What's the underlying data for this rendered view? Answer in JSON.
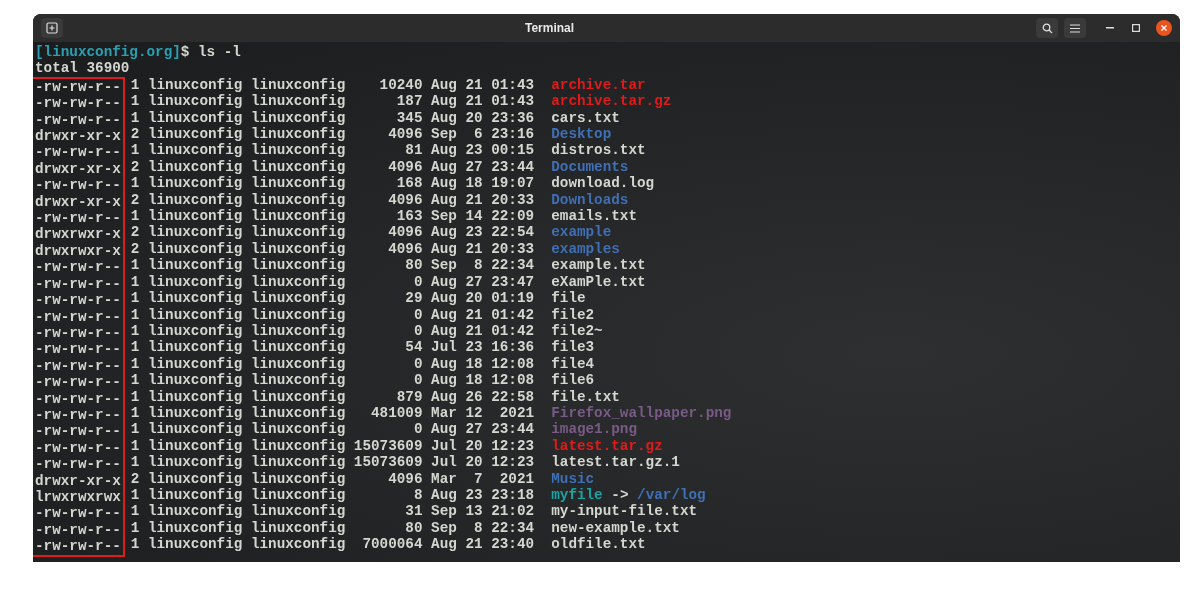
{
  "window": {
    "title": "Terminal"
  },
  "prompt": {
    "host": "[linuxconfig.org]",
    "command": "$ ls -l"
  },
  "total": "total 36900",
  "highlight_permissions": true,
  "rows": [
    {
      "perms": "-rw-rw-r--",
      "details": "1 linuxconfig linuxconfig    10240 Aug 21 01:43",
      "name": "archive.tar",
      "kind": "archive"
    },
    {
      "perms": "-rw-rw-r--",
      "details": "1 linuxconfig linuxconfig      187 Aug 21 01:43",
      "name": "archive.tar.gz",
      "kind": "archive"
    },
    {
      "perms": "-rw-rw-r--",
      "details": "1 linuxconfig linuxconfig      345 Aug 20 23:36",
      "name": "cars.txt",
      "kind": "file"
    },
    {
      "perms": "drwxr-xr-x",
      "details": "2 linuxconfig linuxconfig     4096 Sep  6 23:16",
      "name": "Desktop",
      "kind": "dir"
    },
    {
      "perms": "-rw-rw-r--",
      "details": "1 linuxconfig linuxconfig       81 Aug 23 00:15",
      "name": "distros.txt",
      "kind": "file"
    },
    {
      "perms": "drwxr-xr-x",
      "details": "2 linuxconfig linuxconfig     4096 Aug 27 23:44",
      "name": "Documents",
      "kind": "dir"
    },
    {
      "perms": "-rw-rw-r--",
      "details": "1 linuxconfig linuxconfig      168 Aug 18 19:07",
      "name": "download.log",
      "kind": "file"
    },
    {
      "perms": "drwxr-xr-x",
      "details": "2 linuxconfig linuxconfig     4096 Aug 21 20:33",
      "name": "Downloads",
      "kind": "dir"
    },
    {
      "perms": "-rw-rw-r--",
      "details": "1 linuxconfig linuxconfig      163 Sep 14 22:09",
      "name": "emails.txt",
      "kind": "file"
    },
    {
      "perms": "drwxrwxr-x",
      "details": "2 linuxconfig linuxconfig     4096 Aug 23 22:54",
      "name": "example",
      "kind": "dir"
    },
    {
      "perms": "drwxrwxr-x",
      "details": "2 linuxconfig linuxconfig     4096 Aug 21 20:33",
      "name": "examples",
      "kind": "dir"
    },
    {
      "perms": "-rw-rw-r--",
      "details": "1 linuxconfig linuxconfig       80 Sep  8 22:34",
      "name": "example.txt",
      "kind": "file"
    },
    {
      "perms": "-rw-rw-r--",
      "details": "1 linuxconfig linuxconfig        0 Aug 27 23:47",
      "name": "eXamPle.txt",
      "kind": "file"
    },
    {
      "perms": "-rw-rw-r--",
      "details": "1 linuxconfig linuxconfig       29 Aug 20 01:19",
      "name": "file",
      "kind": "file"
    },
    {
      "perms": "-rw-rw-r--",
      "details": "1 linuxconfig linuxconfig        0 Aug 21 01:42",
      "name": "file2",
      "kind": "file"
    },
    {
      "perms": "-rw-rw-r--",
      "details": "1 linuxconfig linuxconfig        0 Aug 21 01:42",
      "name": "file2~",
      "kind": "file"
    },
    {
      "perms": "-rw-rw-r--",
      "details": "1 linuxconfig linuxconfig       54 Jul 23 16:36",
      "name": "file3",
      "kind": "file"
    },
    {
      "perms": "-rw-rw-r--",
      "details": "1 linuxconfig linuxconfig        0 Aug 18 12:08",
      "name": "file4",
      "kind": "file"
    },
    {
      "perms": "-rw-rw-r--",
      "details": "1 linuxconfig linuxconfig        0 Aug 18 12:08",
      "name": "file6",
      "kind": "file"
    },
    {
      "perms": "-rw-rw-r--",
      "details": "1 linuxconfig linuxconfig      879 Aug 26 22:58",
      "name": "file.txt",
      "kind": "file"
    },
    {
      "perms": "-rw-rw-r--",
      "details": "1 linuxconfig linuxconfig   481009 Mar 12  2021",
      "name": "Firefox_wallpaper.png",
      "kind": "image"
    },
    {
      "perms": "-rw-rw-r--",
      "details": "1 linuxconfig linuxconfig        0 Aug 27 23:44",
      "name": "image1.png",
      "kind": "image"
    },
    {
      "perms": "-rw-rw-r--",
      "details": "1 linuxconfig linuxconfig 15073609 Jul 20 12:23",
      "name": "latest.tar.gz",
      "kind": "archive"
    },
    {
      "perms": "-rw-rw-r--",
      "details": "1 linuxconfig linuxconfig 15073609 Jul 20 12:23",
      "name": "latest.tar.gz.1",
      "kind": "file"
    },
    {
      "perms": "drwxr-xr-x",
      "details": "2 linuxconfig linuxconfig     4096 Mar  7  2021",
      "name": "Music",
      "kind": "dir"
    },
    {
      "perms": "lrwxrwxrwx",
      "details": "1 linuxconfig linuxconfig        8 Aug 23 23:18",
      "name": "myfile",
      "kind": "link",
      "arrow": "->",
      "target": "/var/log"
    },
    {
      "perms": "-rw-rw-r--",
      "details": "1 linuxconfig linuxconfig       31 Sep 13 21:02",
      "name": "my-input-file.txt",
      "kind": "file"
    },
    {
      "perms": "-rw-rw-r--",
      "details": "1 linuxconfig linuxconfig       80 Sep  8 22:34",
      "name": "new-example.txt",
      "kind": "file"
    },
    {
      "perms": "-rw-rw-r--",
      "details": "1 linuxconfig linuxconfig  7000064 Aug 21 23:40",
      "name": "oldfile.txt",
      "kind": "file"
    }
  ]
}
